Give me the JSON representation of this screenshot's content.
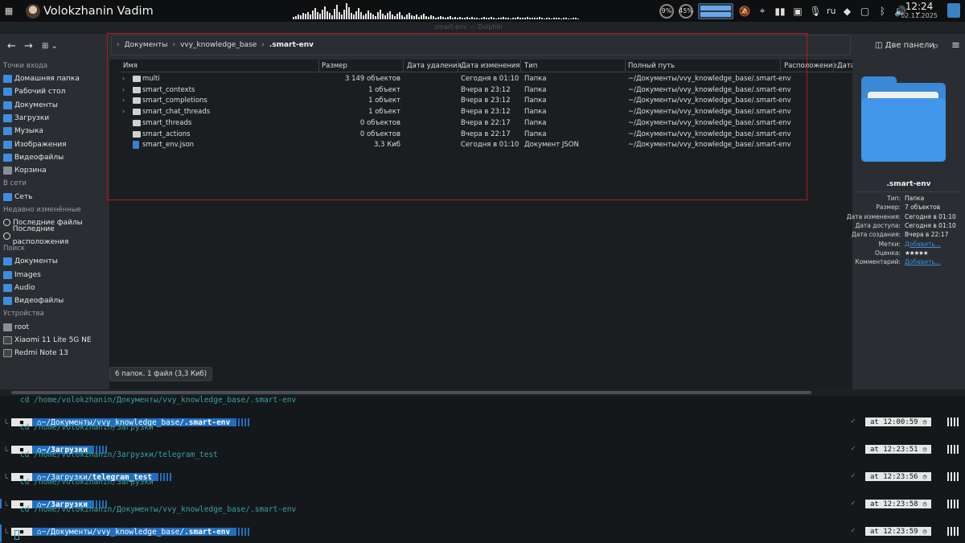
{
  "topbar": {
    "user": "Volokzhanin Vadim",
    "cpu_pct": "9%",
    "mem_pct": "45%",
    "lang": "ru",
    "time": "12:24",
    "date": "02.11.2025"
  },
  "window": {
    "title": "smart-env — Dolphin"
  },
  "toolbar": {
    "split_label": "Две панели"
  },
  "breadcrumb": [
    "Документы",
    "vvy_knowledge_base",
    ".smart-env"
  ],
  "sidebar": {
    "sections": [
      {
        "title": "Точки входа",
        "items": [
          {
            "label": "Домашняя папка",
            "icon": "home-folder-icon"
          },
          {
            "label": "Рабочий стол",
            "icon": "desktop-folder-icon"
          },
          {
            "label": "Документы",
            "icon": "documents-folder-icon"
          },
          {
            "label": "Загрузки",
            "icon": "downloads-folder-icon"
          },
          {
            "label": "Музыка",
            "icon": "music-folder-icon"
          },
          {
            "label": "Изображения",
            "icon": "pictures-folder-icon"
          },
          {
            "label": "Видеофайлы",
            "icon": "videos-folder-icon"
          },
          {
            "label": "Корзина",
            "icon": "trash-icon"
          }
        ]
      },
      {
        "title": "В сети",
        "items": [
          {
            "label": "Сеть",
            "icon": "network-folder-icon"
          }
        ]
      },
      {
        "title": "Недавно изменённые",
        "items": [
          {
            "label": "Последние файлы",
            "icon": "recent-files-icon"
          },
          {
            "label": "Последние расположения",
            "icon": "recent-locations-icon"
          }
        ]
      },
      {
        "title": "Поиск",
        "items": [
          {
            "label": "Документы",
            "icon": "search-documents-icon"
          },
          {
            "label": "Images",
            "icon": "search-images-icon"
          },
          {
            "label": "Audio",
            "icon": "search-audio-icon"
          },
          {
            "label": "Видеофайлы",
            "icon": "search-videos-icon"
          }
        ]
      },
      {
        "title": "Устройства",
        "items": [
          {
            "label": "root",
            "icon": "drive-icon"
          },
          {
            "label": "Xiaomi 11 Lite 5G NE",
            "icon": "phone-icon"
          },
          {
            "label": "Redmi Note 13",
            "icon": "phone-icon"
          }
        ]
      }
    ]
  },
  "columns": [
    "Имя",
    "Размер",
    "Дата удаления",
    "Дата изменения",
    "Тип",
    "Полный путь",
    "Расположение",
    "Дата"
  ],
  "files": [
    {
      "name": "multi",
      "size": "3 149 объектов",
      "modified": "Сегодня в 01:10",
      "type": "Папка",
      "path": "~/Документы/vvy_knowledge_base/.smart-env",
      "expandable": true
    },
    {
      "name": "smart_contexts",
      "size": "1 объект",
      "modified": "Вчера в 23:12",
      "type": "Папка",
      "path": "~/Документы/vvy_knowledge_base/.smart-env",
      "expandable": true
    },
    {
      "name": "smart_completions",
      "size": "1 объект",
      "modified": "Вчера в 23:12",
      "type": "Папка",
      "path": "~/Документы/vvy_knowledge_base/.smart-env",
      "expandable": true
    },
    {
      "name": "smart_chat_threads",
      "size": "1 объект",
      "modified": "Вчера в 23:12",
      "type": "Папка",
      "path": "~/Документы/vvy_knowledge_base/.smart-env",
      "expandable": true
    },
    {
      "name": "smart_threads",
      "size": "0 объектов",
      "modified": "Вчера в 22:17",
      "type": "Папка",
      "path": "~/Документы/vvy_knowledge_base/.smart-env",
      "expandable": false
    },
    {
      "name": "smart_actions",
      "size": "0 объектов",
      "modified": "Вчера в 22:17",
      "type": "Папка",
      "path": "~/Документы/vvy_knowledge_base/.smart-env",
      "expandable": false
    },
    {
      "name": "smart_env.json",
      "size": "3,3 Киб",
      "modified": "Сегодня в 01:10",
      "type": "Документ JSON",
      "path": "~/Документы/vvy_knowledge_base/.smart-env",
      "expandable": false
    }
  ],
  "status": "6 папок. 1 файл (3,3 Киб)",
  "info": {
    "name": ".smart-env",
    "rows": [
      {
        "k": "Тип:",
        "v": "Папка"
      },
      {
        "k": "Размер:",
        "v": "7 объектов"
      },
      {
        "k": "Дата изменения:",
        "v": "Сегодня в 01:10"
      },
      {
        "k": "Дата доступа:",
        "v": "Сегодня в 01:10"
      },
      {
        "k": "Дата создания:",
        "v": "Вчера в 22:17"
      },
      {
        "k": "Метки:",
        "v": "Добавить...",
        "link": true
      },
      {
        "k": "Оценка:",
        "v": "★★★★★",
        "stars": true
      },
      {
        "k": "Комментарий:",
        "v": "Добавить...",
        "link": true
      }
    ]
  },
  "terminal": {
    "blocks": [
      {
        "type": "cd",
        "text": "cd /home/volokzhanin/Документы/vvy_knowledge_base/.smart-env"
      },
      {
        "type": "prompt",
        "path_pre": "~/Документы/vvy_knowledge_base/",
        "path_bold": ".smart-env",
        "time": "at 12:00:59"
      },
      {
        "type": "cd",
        "text": "cd /home/volokzhanin/Загрузки"
      },
      {
        "type": "prompt",
        "path_pre": "",
        "path_bold": "~/Загрузки",
        "time": "at 12:23:51"
      },
      {
        "type": "cd",
        "text": "cd /home/volokzhanin/Загрузки/telegram_test"
      },
      {
        "type": "prompt",
        "path_pre": "~/Загрузки/",
        "path_bold": "telegram_test",
        "time": "at 12:23:56"
      },
      {
        "type": "cd",
        "text": "cd /home/volokzhanin/Загрузки"
      },
      {
        "type": "prompt",
        "path_pre": "",
        "path_bold": "~/Загрузки",
        "time": "at 12:23:58"
      },
      {
        "type": "cd",
        "text": "cd /home/volokzhanin/Документы/vvy_knowledge_base/.smart-env"
      },
      {
        "type": "prompt",
        "path_pre": "~/Документы/vvy_knowledge_base/",
        "path_bold": ".smart-env",
        "time": "at 12:23:59"
      }
    ]
  },
  "colors": {
    "accent": "#3d8ee0",
    "highlight_box": "#b3181f",
    "prompt_path": "#1f6fc0",
    "terminal_cd": "#3aa0a0"
  }
}
